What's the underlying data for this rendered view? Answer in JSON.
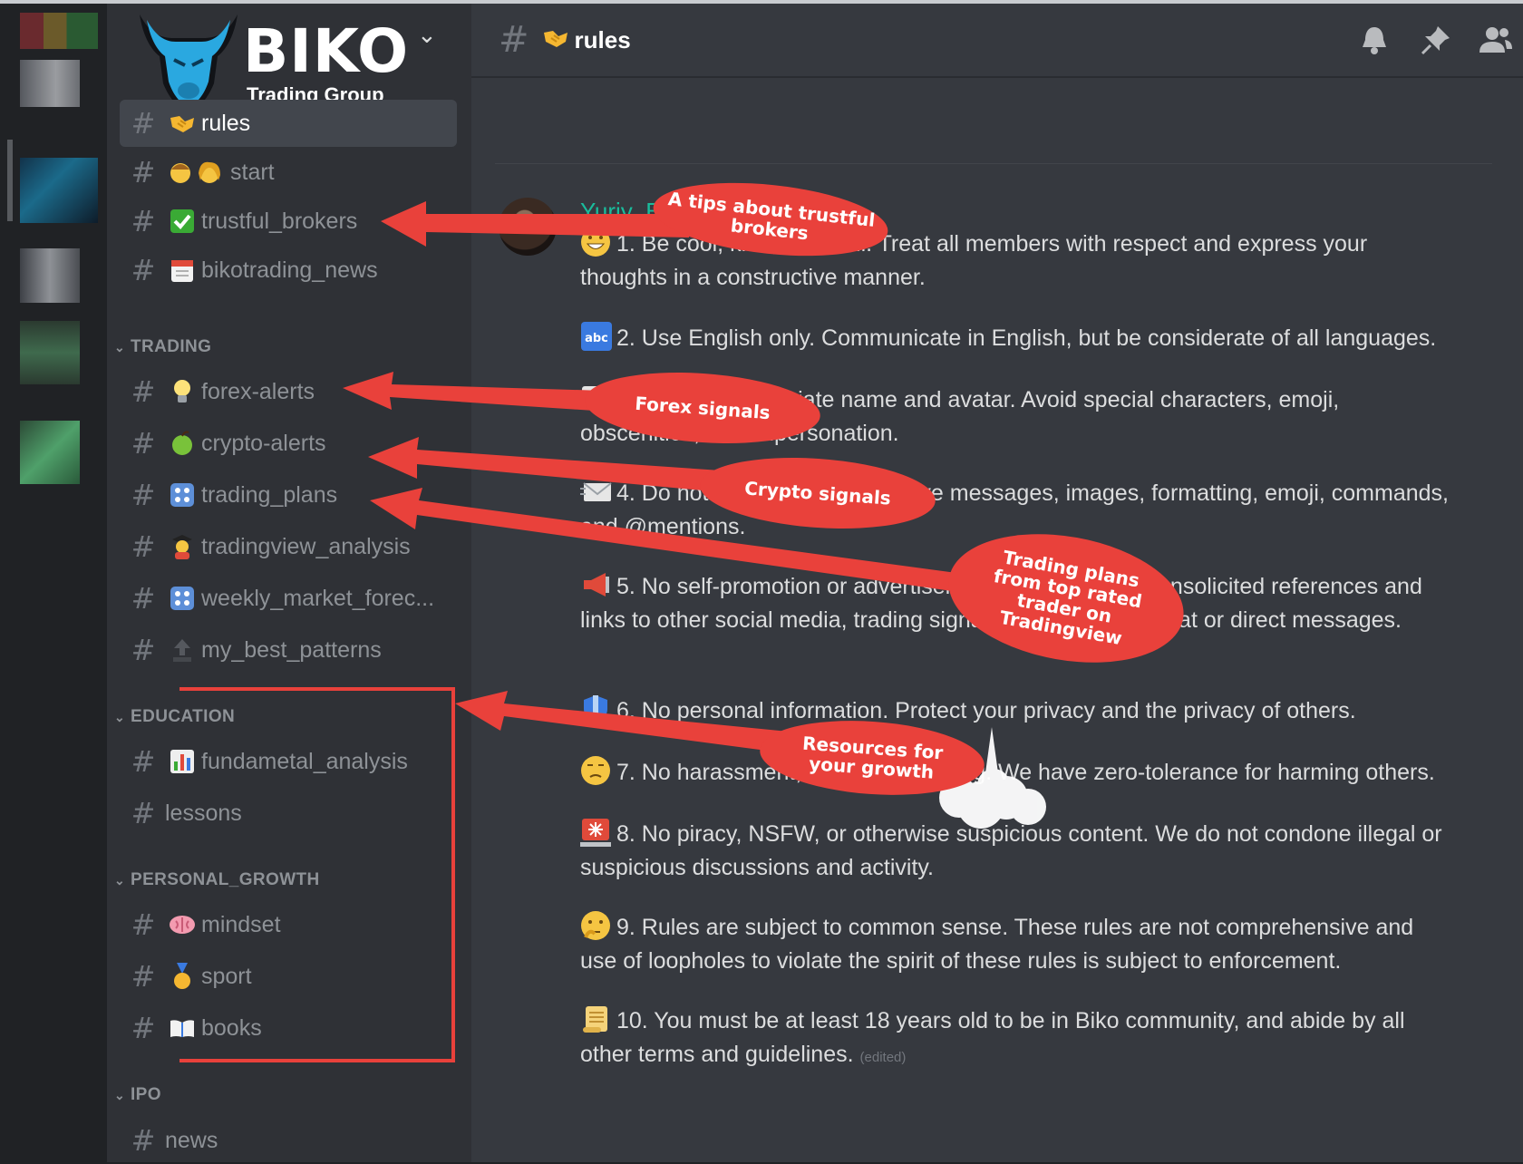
{
  "server": {
    "logo_word": "BIKO",
    "logo_sub": "Trading Group"
  },
  "channels_top": [
    {
      "name": "rules",
      "emoji": "handshake"
    },
    {
      "name": "start",
      "emoji": "people"
    },
    {
      "name": "trustful_brokers",
      "emoji": "check"
    },
    {
      "name": "bikotrading_news",
      "emoji": "calendar"
    }
  ],
  "categories": [
    {
      "label": "TRADING",
      "channels": [
        {
          "name": "forex-alerts",
          "emoji": "bulb"
        },
        {
          "name": "crypto-alerts",
          "emoji": "apple"
        },
        {
          "name": "trading_plans",
          "emoji": "dice"
        },
        {
          "name": "tradingview_analysis",
          "emoji": "student"
        },
        {
          "name": "weekly_market_forec...",
          "emoji": "dice"
        },
        {
          "name": "my_best_patterns",
          "emoji": "top"
        }
      ]
    },
    {
      "label": "EDUCATION",
      "channels": [
        {
          "name": "fundametal_analysis",
          "emoji": "chart"
        },
        {
          "name": "lessons",
          "emoji": ""
        }
      ]
    },
    {
      "label": "PERSONAL_GROWTH",
      "channels": [
        {
          "name": "mindset",
          "emoji": "brain"
        },
        {
          "name": "sport",
          "emoji": "medal"
        },
        {
          "name": "books",
          "emoji": "book"
        }
      ]
    },
    {
      "label": "IPO",
      "channels": [
        {
          "name": "news",
          "emoji": ""
        }
      ]
    }
  ],
  "main": {
    "channel_title": "rules",
    "author": "Yuriy_B",
    "rules": [
      {
        "icon": "grin",
        "text": "1. Be cool, kind, and civil. Treat all members with respect and express your thoughts in a constructive manner."
      },
      {
        "icon": "abc",
        "text": "2. Use English only. Communicate in English, but be considerate of all languages."
      },
      {
        "icon": "id",
        "text": "3. Use an appropriate name and avatar. Avoid special characters, emoji, obscenities, and impersonation."
      },
      {
        "icon": "envelope",
        "text": "4. Do not spam. Avoid excessive messages, images, formatting, emoji, commands, and @mentions."
      },
      {
        "icon": "megaphone",
        "text": "5. No self-promotion or advertisements. This includes unsolicited references and links to other social media, trading signals and servers in chat or direct messages."
      },
      {
        "icon": "shield",
        "text": "6. No personal information. Protect your privacy and the privacy of others."
      },
      {
        "icon": "frown",
        "text": "7. No harassment, abuse, or bullying. We have zero-tolerance for harming others."
      },
      {
        "icon": "siren",
        "text": "8. No piracy, NSFW, or otherwise suspicious content. We do not condone illegal or suspicious discussions and activity."
      },
      {
        "icon": "thinking",
        "text": "9. Rules are subject to common sense. These rules are not comprehensive and use of loopholes to violate the spirit of these rules is subject to enforcement."
      },
      {
        "icon": "scroll",
        "text": "10. You must be at least 18 years old to be in Biko community, and abide by all other terms and guidelines."
      }
    ],
    "edited": "(edited)"
  },
  "annotations": {
    "brokers": "A tips about trustful brokers",
    "forex": "Forex signals",
    "crypto": "Crypto signals",
    "plans": "Trading plans from top rated trader on Tradingview",
    "growth": "Resources for your growth"
  },
  "colors": {
    "accent_red": "#e9413b",
    "author": "#1abc9c",
    "bg_main": "#36393f",
    "bg_sidebar": "#2f3136"
  }
}
